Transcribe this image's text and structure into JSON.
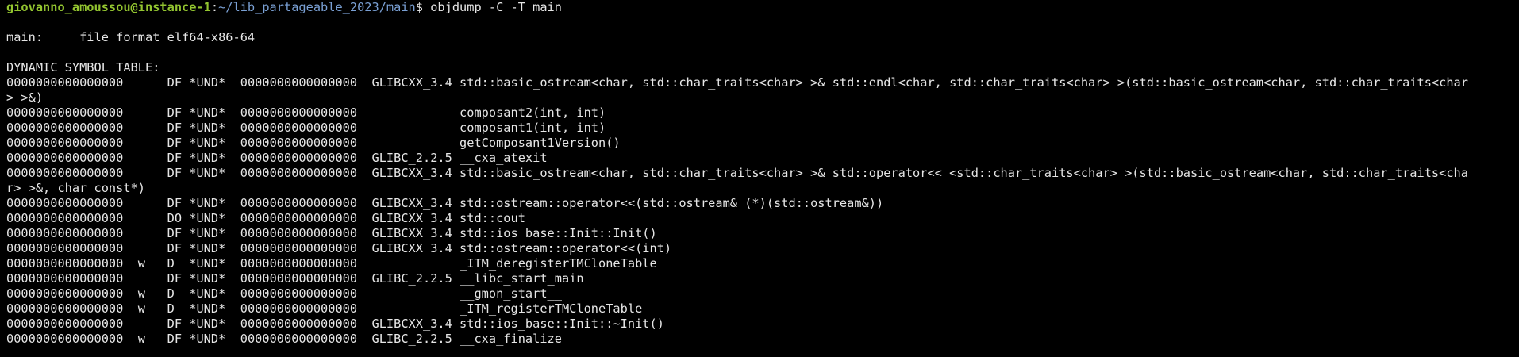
{
  "prompt": {
    "user_host": "giovanno_amoussou@instance-1",
    "colon": ":",
    "path": "~/lib_partageable_2023/main",
    "dollar": "$ ",
    "command": "objdump -C -T main"
  },
  "file_format": "main:     file format elf64-x86-64",
  "table_title": "DYNAMIC SYMBOL TABLE:",
  "rows": [
    {
      "addr": "0000000000000000",
      "flags": "      DF",
      "section": " *UND*",
      "size": "  0000000000000000",
      "version": "  GLIBCXX_3.4",
      "name": " std::basic_ostream<char, std::char_traits<char> >& std::endl<char, std::char_traits<char> >(std::basic_ostream<char, std::char_traits<char"
    },
    {
      "addr": "> >&)",
      "flags": "",
      "section": "",
      "size": "",
      "version": "",
      "name": ""
    },
    {
      "addr": "0000000000000000",
      "flags": "      DF",
      "section": " *UND*",
      "size": "  0000000000000000",
      "version": "             ",
      "name": " composant2(int, int)"
    },
    {
      "addr": "0000000000000000",
      "flags": "      DF",
      "section": " *UND*",
      "size": "  0000000000000000",
      "version": "             ",
      "name": " composant1(int, int)"
    },
    {
      "addr": "0000000000000000",
      "flags": "      DF",
      "section": " *UND*",
      "size": "  0000000000000000",
      "version": "             ",
      "name": " getComposant1Version()"
    },
    {
      "addr": "0000000000000000",
      "flags": "      DF",
      "section": " *UND*",
      "size": "  0000000000000000",
      "version": "  GLIBC_2.2.5",
      "name": " __cxa_atexit"
    },
    {
      "addr": "0000000000000000",
      "flags": "      DF",
      "section": " *UND*",
      "size": "  0000000000000000",
      "version": "  GLIBCXX_3.4",
      "name": " std::basic_ostream<char, std::char_traits<char> >& std::operator<< <std::char_traits<char> >(std::basic_ostream<char, std::char_traits<cha"
    },
    {
      "addr": "r> >&, char const*)",
      "flags": "",
      "section": "",
      "size": "",
      "version": "",
      "name": ""
    },
    {
      "addr": "0000000000000000",
      "flags": "      DF",
      "section": " *UND*",
      "size": "  0000000000000000",
      "version": "  GLIBCXX_3.4",
      "name": " std::ostream::operator<<(std::ostream& (*)(std::ostream&))"
    },
    {
      "addr": "0000000000000000",
      "flags": "      DO",
      "section": " *UND*",
      "size": "  0000000000000000",
      "version": "  GLIBCXX_3.4",
      "name": " std::cout"
    },
    {
      "addr": "0000000000000000",
      "flags": "      DF",
      "section": " *UND*",
      "size": "  0000000000000000",
      "version": "  GLIBCXX_3.4",
      "name": " std::ios_base::Init::Init()"
    },
    {
      "addr": "0000000000000000",
      "flags": "      DF",
      "section": " *UND*",
      "size": "  0000000000000000",
      "version": "  GLIBCXX_3.4",
      "name": " std::ostream::operator<<(int)"
    },
    {
      "addr": "0000000000000000",
      "flags": "  w   D ",
      "section": " *UND*",
      "size": "  0000000000000000",
      "version": "             ",
      "name": " _ITM_deregisterTMCloneTable"
    },
    {
      "addr": "0000000000000000",
      "flags": "      DF",
      "section": " *UND*",
      "size": "  0000000000000000",
      "version": "  GLIBC_2.2.5",
      "name": " __libc_start_main"
    },
    {
      "addr": "0000000000000000",
      "flags": "  w   D ",
      "section": " *UND*",
      "size": "  0000000000000000",
      "version": "             ",
      "name": " __gmon_start__"
    },
    {
      "addr": "0000000000000000",
      "flags": "  w   D ",
      "section": " *UND*",
      "size": "  0000000000000000",
      "version": "             ",
      "name": " _ITM_registerTMCloneTable"
    },
    {
      "addr": "0000000000000000",
      "flags": "      DF",
      "section": " *UND*",
      "size": "  0000000000000000",
      "version": "  GLIBCXX_3.4",
      "name": " std::ios_base::Init::~Init()"
    },
    {
      "addr": "0000000000000000",
      "flags": "  w   DF",
      "section": " *UND*",
      "size": "  0000000000000000",
      "version": "  GLIBC_2.2.5",
      "name": " __cxa_finalize"
    }
  ],
  "colors": {
    "background": "#000000",
    "text": "#e6e6e6",
    "prompt_user": "#93c530",
    "prompt_path": "#7aa0d4"
  }
}
